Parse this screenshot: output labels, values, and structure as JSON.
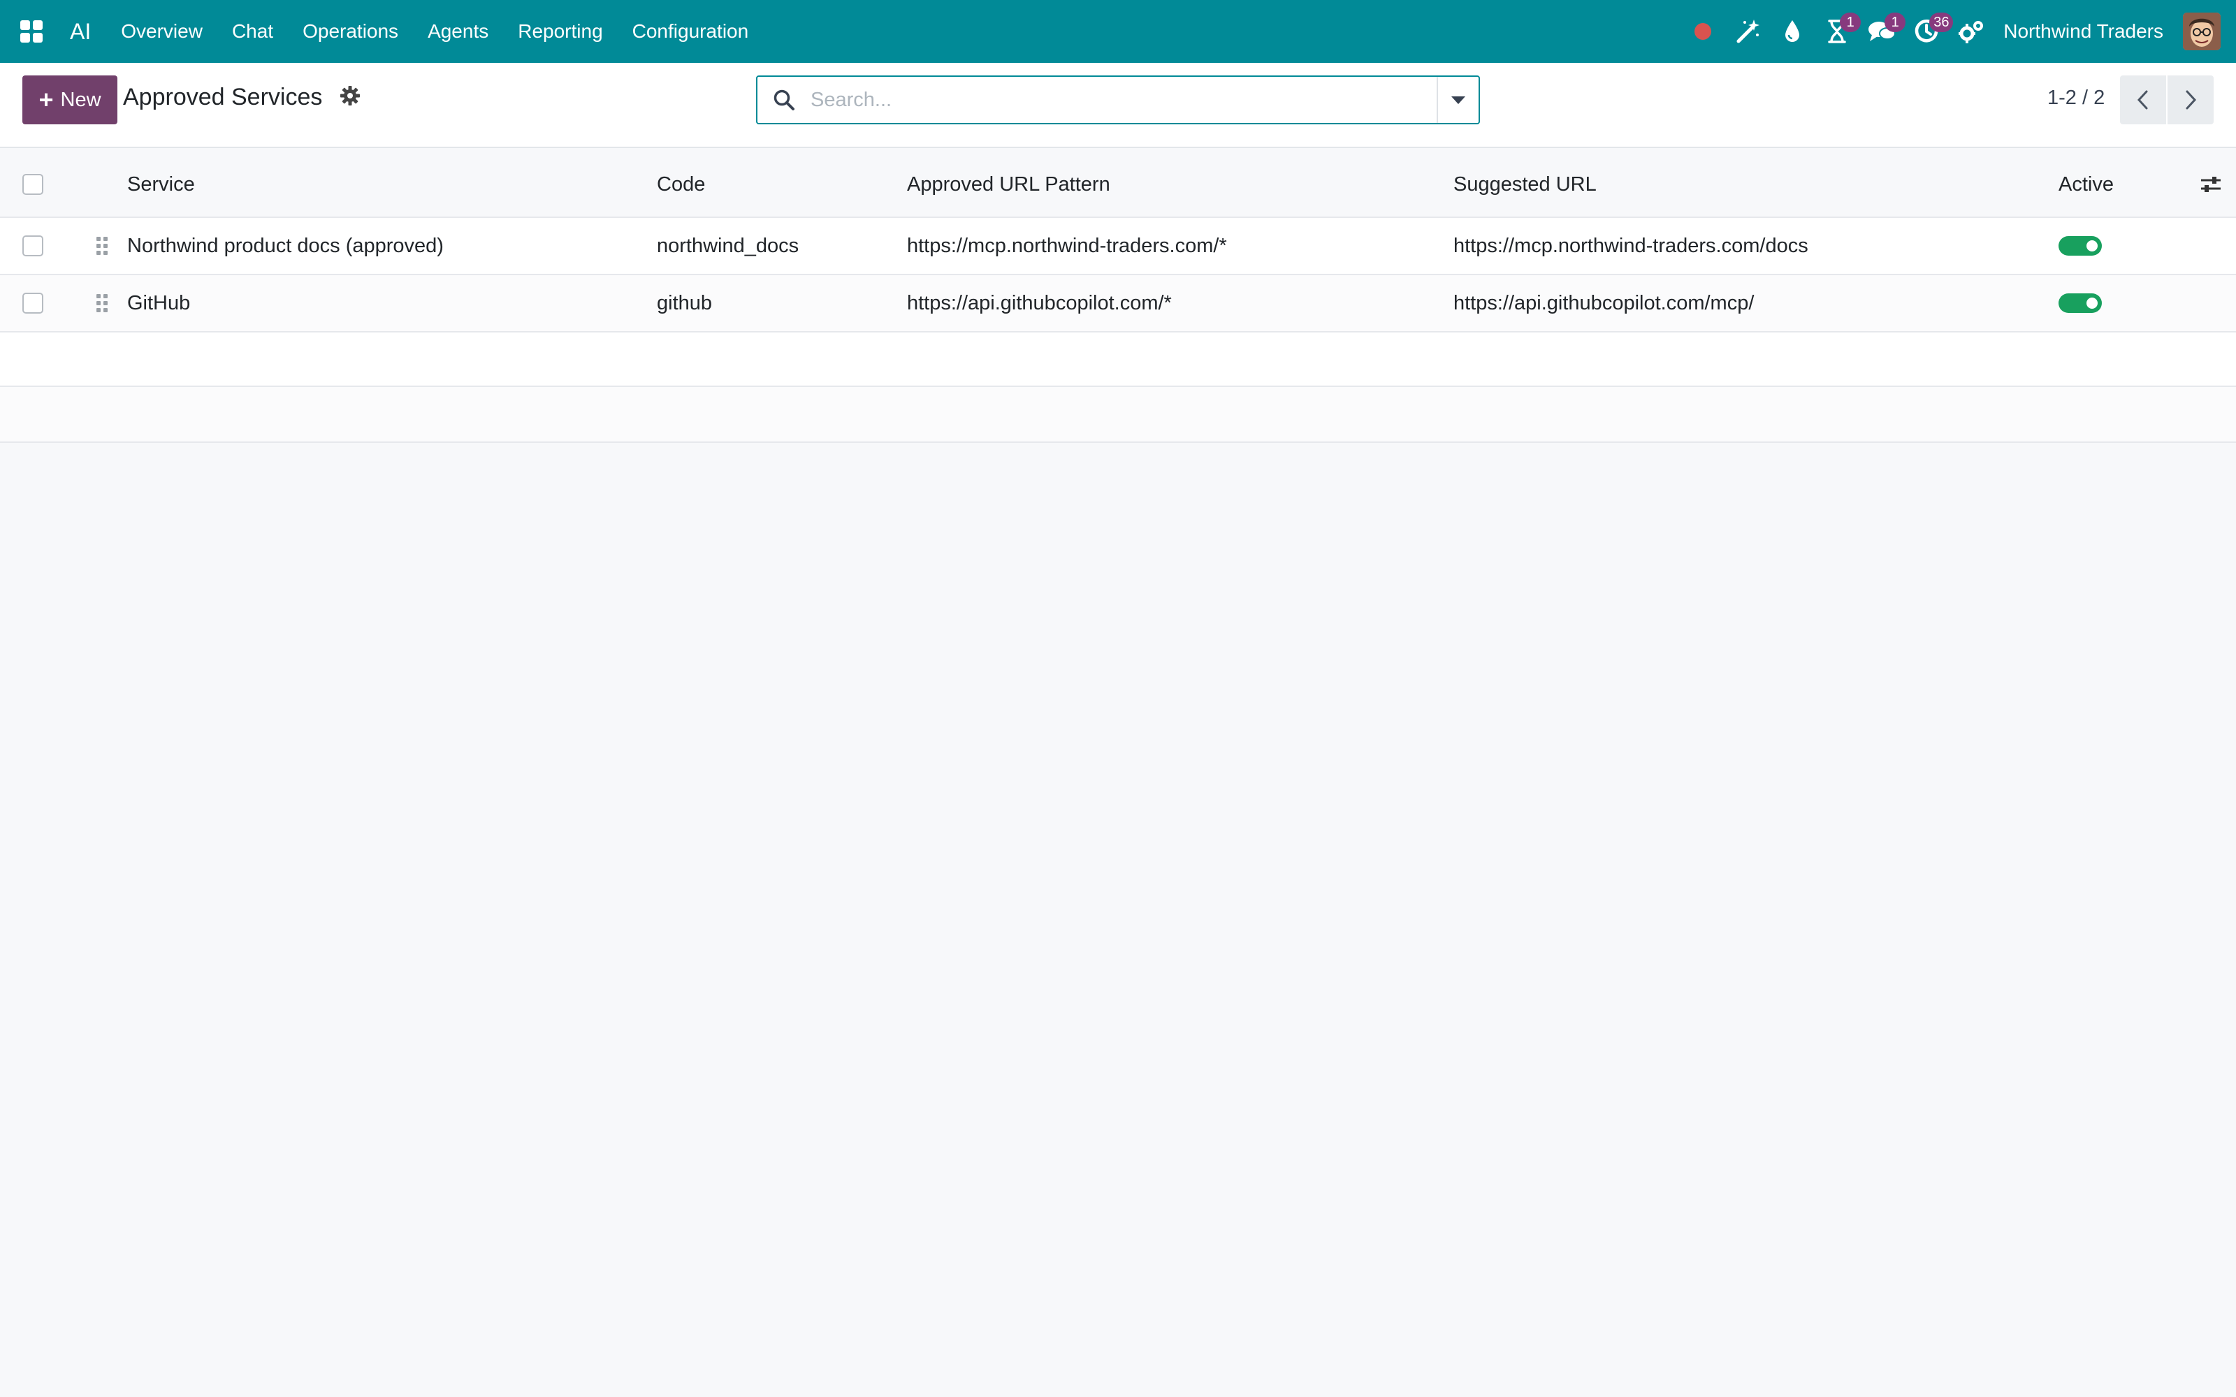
{
  "navbar": {
    "app_name": "AI",
    "menu": [
      "Overview",
      "Chat",
      "Operations",
      "Agents",
      "Reporting",
      "Configuration"
    ],
    "activity_badge": "1",
    "messages_badge": "1",
    "clock_badge": "36",
    "company": "Northwind Traders"
  },
  "control_panel": {
    "new_label": "New",
    "title": "Approved Services",
    "search_placeholder": "Search...",
    "pager": "1-2 / 2"
  },
  "table": {
    "columns": {
      "service": "Service",
      "code": "Code",
      "url_pattern": "Approved URL Pattern",
      "suggested_url": "Suggested URL",
      "active": "Active"
    },
    "rows": [
      {
        "service": "Northwind product docs (approved)",
        "code": "northwind_docs",
        "url_pattern": "https://mcp.northwind-traders.com/*",
        "suggested_url": "https://mcp.northwind-traders.com/docs",
        "active": true
      },
      {
        "service": "GitHub",
        "code": "github",
        "url_pattern": "https://api.githubcopilot.com/*",
        "suggested_url": "https://api.githubcopilot.com/mcp/",
        "active": true
      }
    ]
  },
  "colors": {
    "navbar": "#018a97",
    "primary_button": "#71406b",
    "badge": "#873a7e",
    "toggle_on": "#18a05e",
    "recording_dot": "#d9534f"
  }
}
